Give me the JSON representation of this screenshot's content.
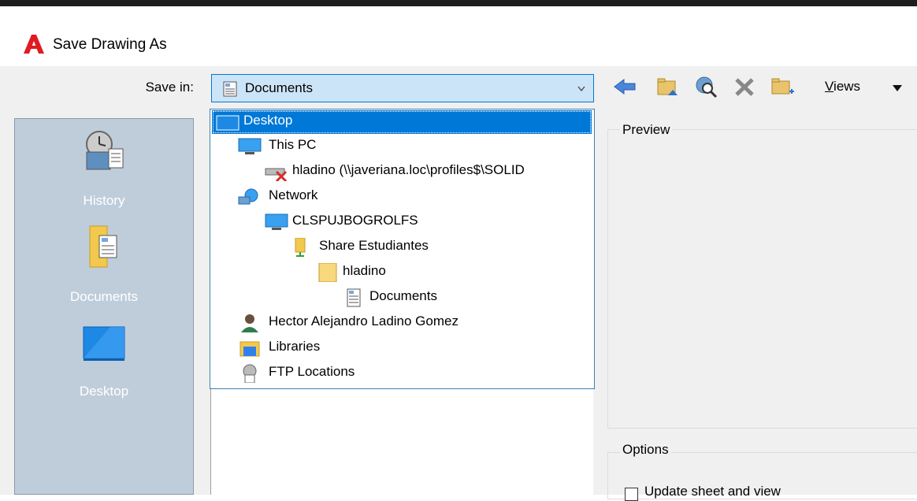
{
  "window": {
    "title": "Save Drawing As"
  },
  "save_in": {
    "label": "Save in:",
    "value": "Documents"
  },
  "toolbar": {
    "views_label_underlined": "V",
    "views_label_rest": "iews",
    "buttons": [
      "back-icon",
      "up-one-level-icon",
      "search-web-icon",
      "delete-icon",
      "create-folder-icon"
    ]
  },
  "places": {
    "items": [
      {
        "label": "History",
        "icon": "history-icon"
      },
      {
        "label": "Documents",
        "icon": "documents-folder-icon"
      },
      {
        "label": "Desktop",
        "icon": "desktop-icon"
      }
    ]
  },
  "dropdown": {
    "items": [
      {
        "label": "Desktop",
        "icon": "desktop-icon",
        "selected": true
      },
      {
        "label": "This PC",
        "icon": "computer-icon"
      },
      {
        "label": "hladino (\\\\javeriana.loc\\profiles$\\SOLID",
        "icon": "disconnected-drive-icon"
      },
      {
        "label": "Network",
        "icon": "network-icon"
      },
      {
        "label": "CLSPUJBOGROLFS",
        "icon": "computer-icon"
      },
      {
        "label": "Share Estudiantes",
        "icon": "shared-folder-icon"
      },
      {
        "label": "hladino",
        "icon": "folder-icon"
      },
      {
        "label": "Documents",
        "icon": "documents-icon"
      },
      {
        "label": "Hector Alejandro Ladino Gomez",
        "icon": "user-icon"
      },
      {
        "label": "Libraries",
        "icon": "libraries-icon"
      },
      {
        "label": "FTP Locations",
        "icon": "ftp-icon"
      }
    ]
  },
  "preview": {
    "label": "Preview"
  },
  "options": {
    "label": "Options",
    "checkbox_text": "Update sheet and view"
  },
  "colors": {
    "accent": "#0078d7",
    "combo_bg": "#cce4f7",
    "places_bg": "#bfcddb",
    "app_icon_red": "#e11b22"
  }
}
